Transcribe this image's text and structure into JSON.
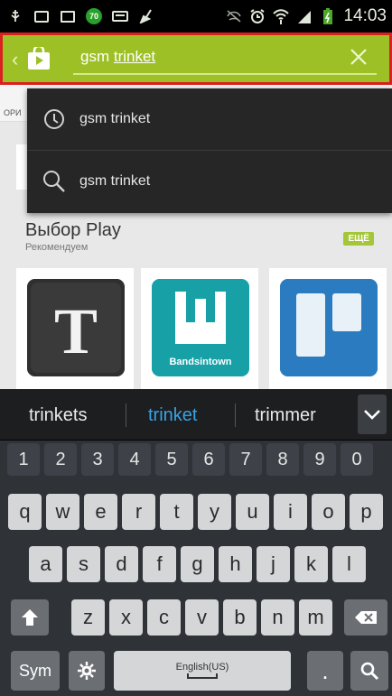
{
  "status_bar": {
    "time": "14:03",
    "badge": "70",
    "icons": [
      "usb-icon",
      "image-icon",
      "box-icon",
      "badge-70-icon",
      "message-icon",
      "broom-icon",
      "silent-icon",
      "alarm-icon",
      "wifi-icon",
      "signal-icon",
      "battery-icon"
    ]
  },
  "search_bar": {
    "query_prefix": "gsm ",
    "query_underlined": "trinket",
    "accent_color": "#9ec027"
  },
  "page": {
    "tab_fragment": "ОРИ",
    "section_title": "Выбор Play",
    "section_subtitle": "Рекомендуем",
    "more_label": "ЕЩЁ",
    "apps": [
      {
        "name": "nytimes-app-icon",
        "glyph": "T"
      },
      {
        "name": "bandsintown-app-icon",
        "label": "Bandsintown"
      },
      {
        "name": "trello-app-icon"
      }
    ]
  },
  "suggestions": [
    {
      "type": "history",
      "icon": "history-clock-icon",
      "text": "gsm trinket"
    },
    {
      "type": "search",
      "icon": "search-icon",
      "text": "gsm trinket"
    }
  ],
  "keyboard": {
    "predictions": [
      "trinkets",
      "trinket",
      "trimmer"
    ],
    "number_row": [
      "1",
      "2",
      "3",
      "4",
      "5",
      "6",
      "7",
      "8",
      "9",
      "0"
    ],
    "row1": [
      "q",
      "w",
      "e",
      "r",
      "t",
      "y",
      "u",
      "i",
      "o",
      "p"
    ],
    "row2": [
      "a",
      "s",
      "d",
      "f",
      "g",
      "h",
      "j",
      "k",
      "l"
    ],
    "row3": [
      "z",
      "x",
      "c",
      "v",
      "b",
      "n",
      "m"
    ],
    "sym_label": "Sym",
    "space_label": "English(US)",
    "period_label": ".",
    "period_sub": "\"?"
  }
}
